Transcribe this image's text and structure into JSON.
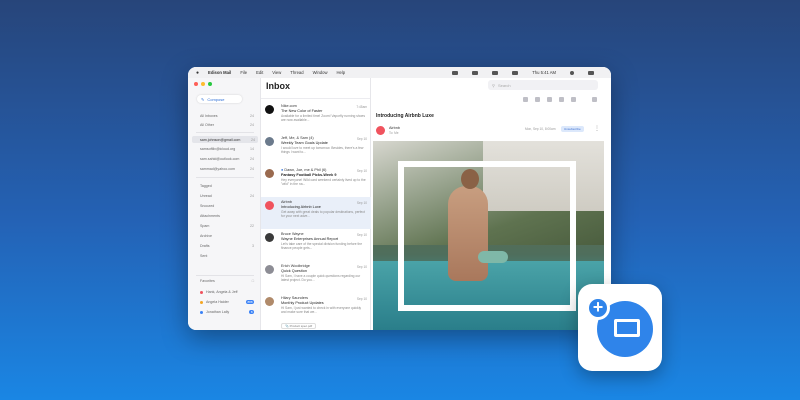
{
  "menubar": {
    "app_name": "Edison Mail",
    "items": [
      "File",
      "Edit",
      "View",
      "Thread",
      "Window",
      "Help"
    ],
    "clock": "Thu 5:41 AM"
  },
  "sidebar": {
    "compose_label": "Compose",
    "mailboxes": [
      {
        "label": "All Inboxes",
        "count": "24"
      },
      {
        "label": "All Other",
        "count": "24"
      }
    ],
    "accounts": [
      {
        "label": "sam.johnson@gmail.com",
        "count": "24"
      },
      {
        "label": "samsoftlix@icloud.org",
        "count": "14"
      },
      {
        "label": "sam.sahid@outlook.com",
        "count": "24"
      },
      {
        "label": "sammad@yahoo.com",
        "count": "24"
      }
    ],
    "folders": [
      {
        "label": "Tagged",
        "count": ""
      },
      {
        "label": "Unread",
        "count": "24"
      },
      {
        "label": "Snoozed",
        "count": ""
      },
      {
        "label": "Attachments",
        "count": ""
      },
      {
        "label": "Spam",
        "count": "22"
      },
      {
        "label": "Archive",
        "count": ""
      },
      {
        "label": "Drafts",
        "count": "3"
      },
      {
        "label": "Sent",
        "count": ""
      }
    ],
    "favorites_header": "Favorites",
    "favorites": [
      {
        "label": "Hank, Angela & Jeff",
        "count": ""
      },
      {
        "label": "Angela Haider",
        "count": "888"
      },
      {
        "label": "Jonathan Lally",
        "count": "8"
      }
    ]
  },
  "list": {
    "title": "Inbox",
    "emails": [
      {
        "sender": "Nike.com",
        "time": "7:45am",
        "subject": "The New Color of Faster",
        "snippet": "Available for a limited time! Zoom! Vaporfly running shoes are now available..."
      },
      {
        "sender": "Jeff, Me, & Sam (4)",
        "time": "Sep 10",
        "subject": "Weekly Team Goals Update",
        "snippet": "I would love to meet up tomorrow. Besides, there's a few things I want to..."
      },
      {
        "sender": "Dawn, Joe, me & Phil (6)",
        "time": "Sep 10",
        "subject": "Fantasy Football Picks-Week 9",
        "snippet": "Hey everyone! Wild card weekend certainly lived up to the \"wild\" in the na..."
      },
      {
        "sender": "Airbnb",
        "time": "Sep 10",
        "subject": "Introducing Airbnb Luxe",
        "snippet": "Get away with great deals to popular destinations, perfect for your next adve..."
      },
      {
        "sender": "Bruce Wayne",
        "time": "Sep 10",
        "subject": "Wayne Enterprises Annual Report",
        "snippet": "Let's take care of the special division funding before the finance people gets..."
      },
      {
        "sender": "Erich Woolbridge",
        "time": "Sep 10",
        "subject": "Quick Question",
        "snippet": "Hi Sam, I have a couple quick questions regarding our latest project. Do you..."
      },
      {
        "sender": "Hilary Saunders",
        "time": "Sep 10",
        "subject": "Monthly Product Updates",
        "snippet": "Hi Sam, I just wanted to check in with everyone quickly and make sure that we..."
      }
    ],
    "attachment_label": "Product spec.pdf"
  },
  "reader": {
    "search_placeholder": "Search",
    "subject": "Introducing Airbnb Luxe",
    "sender": "Airbnb",
    "to": "To: Me",
    "time": "Mon, Sep 10, 8:00am",
    "badge": "Unsubscribe"
  },
  "colors": {
    "accent": "#2f84ea",
    "airbnb": "#f0535e",
    "selected_row": "#e9eff9"
  }
}
